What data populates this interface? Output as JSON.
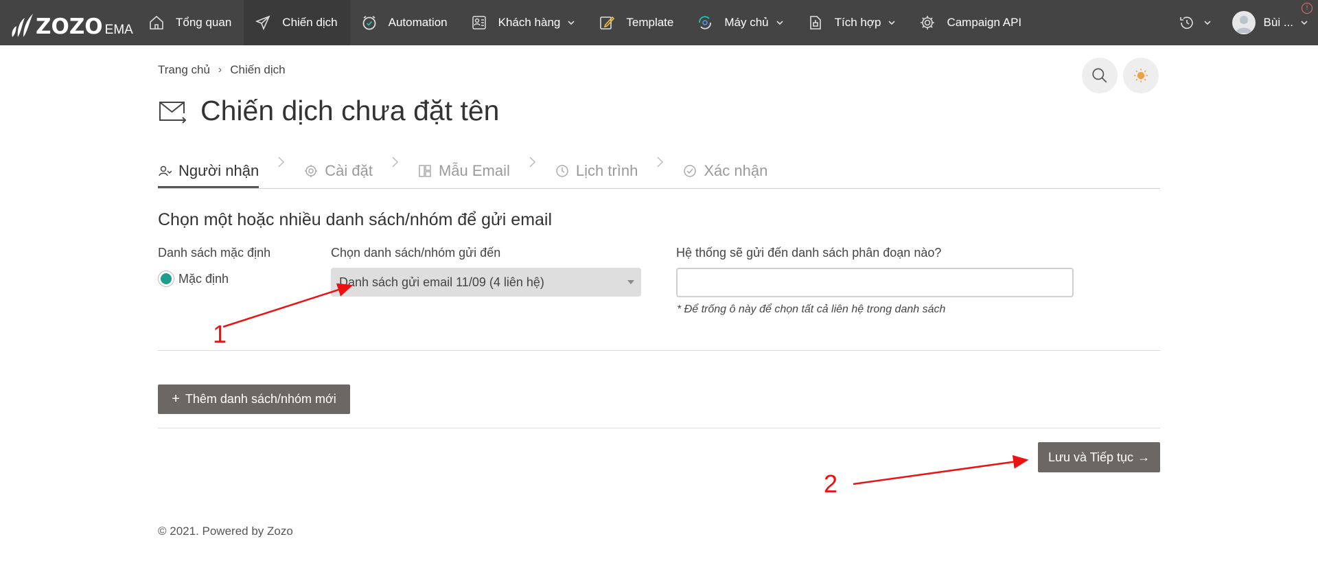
{
  "app": {
    "logo_text": "ZOZO",
    "logo_sub": "EMA"
  },
  "nav": {
    "items": [
      {
        "label": "Tổng quan",
        "icon": "home-icon"
      },
      {
        "label": "Chiến dịch",
        "icon": "send-icon",
        "active": true
      },
      {
        "label": "Automation",
        "icon": "automation-clock-icon"
      },
      {
        "label": "Khách hàng",
        "icon": "contacts-icon",
        "dropdown": true
      },
      {
        "label": "Template",
        "icon": "edit-pen-icon"
      },
      {
        "label": "Máy chủ",
        "icon": "server-sync-icon",
        "dropdown": true
      },
      {
        "label": "Tích hợp",
        "icon": "integration-icon",
        "dropdown": true
      },
      {
        "label": "Campaign API",
        "icon": "gear-api-icon"
      }
    ],
    "user_name": "Bùi ...",
    "alert_mark": "!"
  },
  "breadcrumb": {
    "home": "Trang chủ",
    "separator": "›",
    "current": "Chiến dịch"
  },
  "page": {
    "title": "Chiến dịch chưa đặt tên"
  },
  "steps": [
    {
      "label": "Người nhận",
      "icon": "recipient-icon",
      "active": true
    },
    {
      "label": "Cài đặt",
      "icon": "settings-icon"
    },
    {
      "label": "Mẫu Email",
      "icon": "template-layout-icon"
    },
    {
      "label": "Lịch trình",
      "icon": "clock-icon"
    },
    {
      "label": "Xác nhận",
      "icon": "check-circle-icon"
    }
  ],
  "form": {
    "section_title": "Chọn một hoặc nhiều danh sách/nhóm để gửi email",
    "default_list_label": "Danh sách mặc định",
    "default_radio_label": "Mặc định",
    "select_label": "Chọn danh sách/nhóm gửi đến",
    "select_value": "Danh sách gửi email 11/09 (4 liên hệ)",
    "segment_label": "Hệ thống sẽ gửi đến danh sách phân đoạn nào?",
    "segment_value": "",
    "segment_hint": "* Để trống ô này để chọn tất cả liên hệ trong danh sách",
    "add_button": "Thêm danh sách/nhóm mới",
    "add_button_icon": "+",
    "save_button": "Lưu và Tiếp tục",
    "save_button_icon": "→"
  },
  "footer": {
    "text": "© 2021. Powered by Zozo"
  },
  "annotations": {
    "color": "#ee1111",
    "marker_1": "1",
    "marker_2": "2"
  }
}
